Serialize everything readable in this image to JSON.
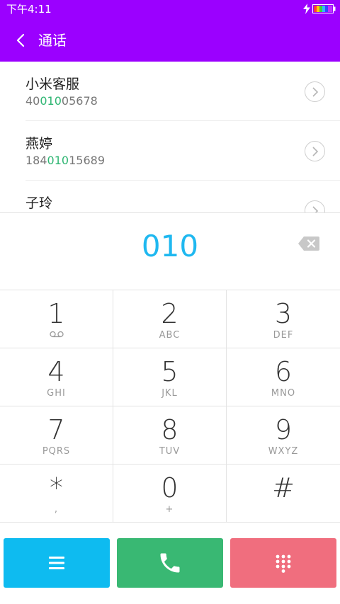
{
  "status_bar": {
    "time": "下午4:11",
    "icons": [
      "bolt-icon",
      "battery-icon"
    ]
  },
  "app_bar": {
    "back_icon": "chevron-left-icon",
    "title": "通话"
  },
  "contacts": [
    {
      "name": "小米客服",
      "number_prefix": "40",
      "number_match": "010",
      "number_suffix": "05678"
    },
    {
      "name": "燕婷",
      "number_prefix": "184",
      "number_match": "010",
      "number_suffix": "15689"
    },
    {
      "name": "子玲",
      "number_prefix": "",
      "number_match": "",
      "number_suffix": ""
    }
  ],
  "dialer": {
    "dialed_number": "010",
    "backspace_icon": "backspace-icon"
  },
  "keypad": {
    "keys": [
      {
        "digit": "1",
        "letters": "",
        "sub_icon": "voicemail-icon"
      },
      {
        "digit": "2",
        "letters": "ABC"
      },
      {
        "digit": "3",
        "letters": "DEF"
      },
      {
        "digit": "4",
        "letters": "GHI"
      },
      {
        "digit": "5",
        "letters": "JKL"
      },
      {
        "digit": "6",
        "letters": "MNO"
      },
      {
        "digit": "7",
        "letters": "PQRS"
      },
      {
        "digit": "8",
        "letters": "TUV"
      },
      {
        "digit": "9",
        "letters": "WXYZ"
      },
      {
        "digit": "*",
        "letters": ","
      },
      {
        "digit": "0",
        "letters": "+"
      },
      {
        "digit": "#",
        "letters": ""
      }
    ]
  },
  "actions": {
    "menu_icon": "menu-icon",
    "call_icon": "phone-icon",
    "keypad_icon": "dialpad-icon"
  },
  "colors": {
    "header": "#9b00ff",
    "accent_blue": "#1fb8f0",
    "match_green": "#2fb673",
    "menu_button": "#0ebbf0",
    "call_button": "#39b873",
    "keypad_button": "#f06e7e"
  }
}
